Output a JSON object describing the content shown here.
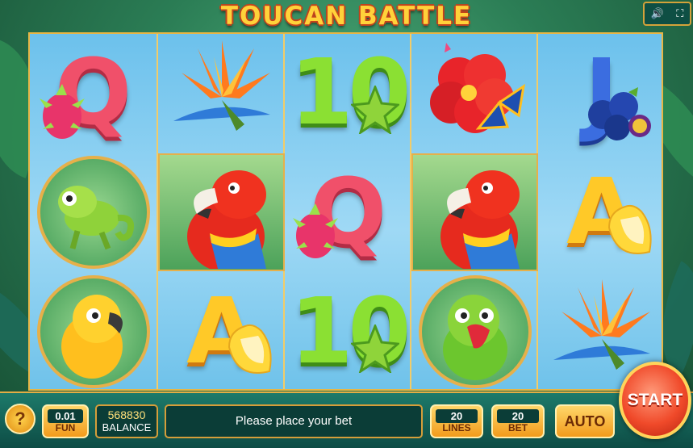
{
  "title": "TOUCAN BATTLE",
  "top_controls": {
    "sound_icon": "🔊",
    "fullscreen_icon": "⛶"
  },
  "reels": {
    "symbols": [
      [
        "Q + dragon fruit",
        "Chameleon",
        "Sun parakeet"
      ],
      [
        "Bird of paradise flower",
        "Scarlet macaw",
        "A + banana"
      ],
      [
        "10 + star fruit",
        "Q + dragon fruit",
        "10 + star fruit"
      ],
      [
        "Hibiscus + butterfly",
        "Scarlet macaw",
        "Green parrot"
      ],
      [
        "J + blueberries",
        "A + banana",
        "Bird of paradise flower"
      ]
    ],
    "letters": {
      "q": "Q",
      "ten": "10",
      "a": "A",
      "j": "J"
    }
  },
  "bottom": {
    "help": "?",
    "coin_value": "0.01",
    "coin_label": "FUN",
    "balance_value": "568830",
    "balance_label": "BALANCE",
    "message": "Please place your bet",
    "lines_value": "20",
    "lines_label": "LINES",
    "bet_value": "20",
    "bet_label": "BET",
    "auto": "AUTO",
    "start": "START"
  }
}
